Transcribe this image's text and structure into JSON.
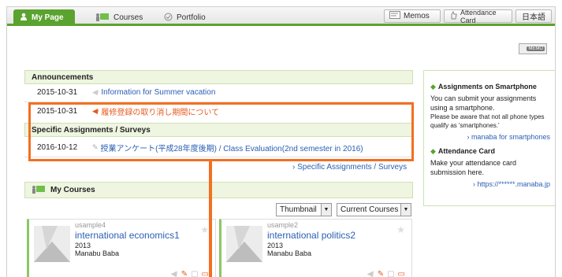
{
  "nav": {
    "tabs": [
      {
        "label": "My Page",
        "icon": "user-icon",
        "active": true
      },
      {
        "label": "Courses",
        "icon": "courses-icon",
        "active": false
      },
      {
        "label": "Portfolio",
        "icon": "portfolio-icon",
        "active": false
      }
    ],
    "memos_label": "Memos",
    "attendance_label": "Attendance Card",
    "language_label": "日本語"
  },
  "memo_icon_label": "MEMO",
  "announcements": {
    "heading": "Announcements",
    "items": [
      {
        "date": "2015-10-31",
        "text": "Information for Summer vacation",
        "color": "#2b5fb3"
      },
      {
        "date": "2015-10-31",
        "text": "履修登録の取り消し期間について",
        "color": "#e8581c"
      }
    ]
  },
  "assignments": {
    "heading": "Specific Assignments / Surveys",
    "items": [
      {
        "date": "2016-10-12",
        "text": "授業アンケート(平成28年度後期) / Class Evaluation(2nd semester in 2016)"
      }
    ],
    "more_link": "Specific Assignments / Surveys"
  },
  "right_box": {
    "smartphone_heading": "Assignments on Smartphone",
    "smartphone_text": "You can submit your assignments using a smartphone.",
    "smartphone_note": "Please be aware that not all phone types qualify as 'smartphones.'",
    "smartphone_link": "manaba for smartphones",
    "attendance_heading": "Attendance Card",
    "attendance_text": "Make your attendance card submission here.",
    "attendance_link": "https://******.manaba.jp"
  },
  "my_courses": {
    "heading": "My Courses",
    "view_select": "Thumbnail",
    "filter_select": "Current Courses",
    "courses": [
      {
        "code": "usample4",
        "title": "international economics1",
        "year": "2013",
        "teacher": "Manabu Baba"
      },
      {
        "code": "usample2",
        "title": "international politics2",
        "year": "2013",
        "teacher": "Manabu Baba"
      }
    ]
  },
  "colors": {
    "accent_green": "#5aa32f",
    "highlight_orange": "#f36f21",
    "link_blue": "#2b5fb3"
  }
}
